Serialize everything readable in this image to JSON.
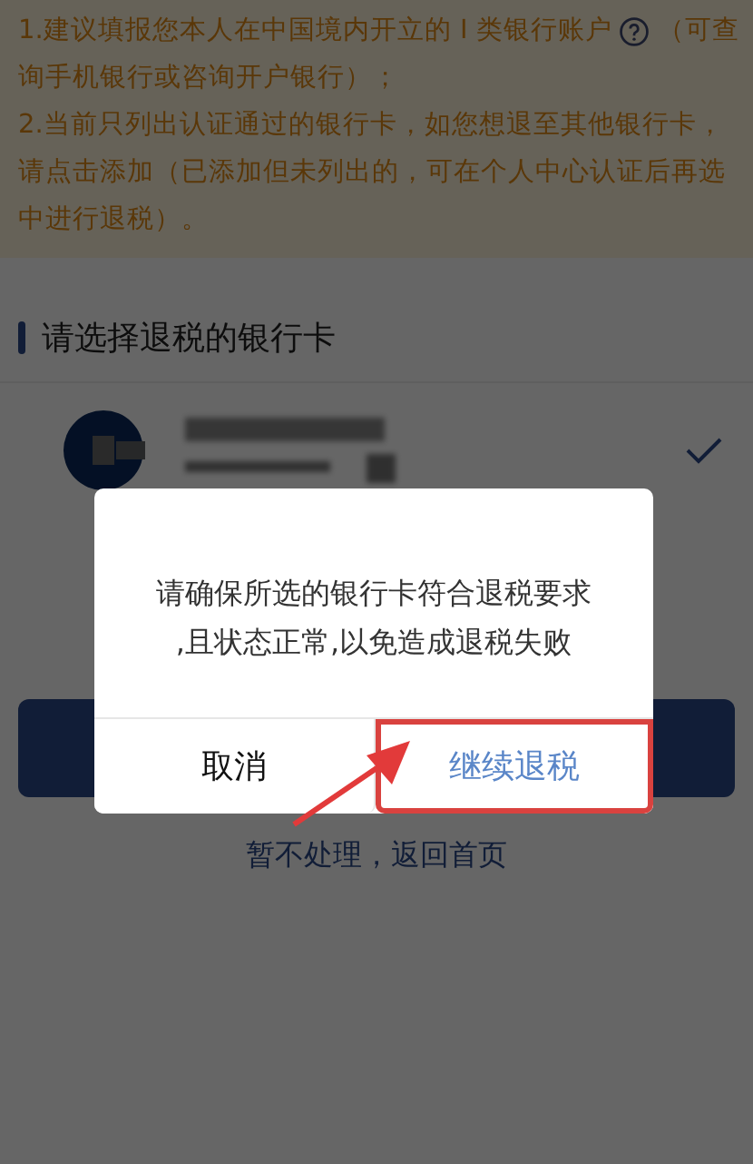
{
  "notice": {
    "item_1": {
      "before_icon": "1.建议填报您本人在中国境内开立的 I 类银行账户",
      "after_icon": "（可查",
      "line_2": "询手机银行或咨询开户银行）；"
    },
    "item_2": "2.当前只列出认证通过的银行卡，如您想退至其他银行卡，请点击添加（已添加但未列出的，可在个人中心认证后再选中进行退税）。"
  },
  "section_title": "请选择退税的银行卡",
  "cards": [
    {
      "selected": true
    }
  ],
  "back_link": "暂不处理，返回首页",
  "dialog": {
    "message": "请确保所选的银行卡符合退税要求,且状态正常,以免造成退税失败",
    "buttons": [
      {
        "kind": "cancel",
        "label": "取消",
        "highlighted": false
      },
      {
        "kind": "confirm",
        "label": "继续退税",
        "highlighted": true
      }
    ]
  }
}
